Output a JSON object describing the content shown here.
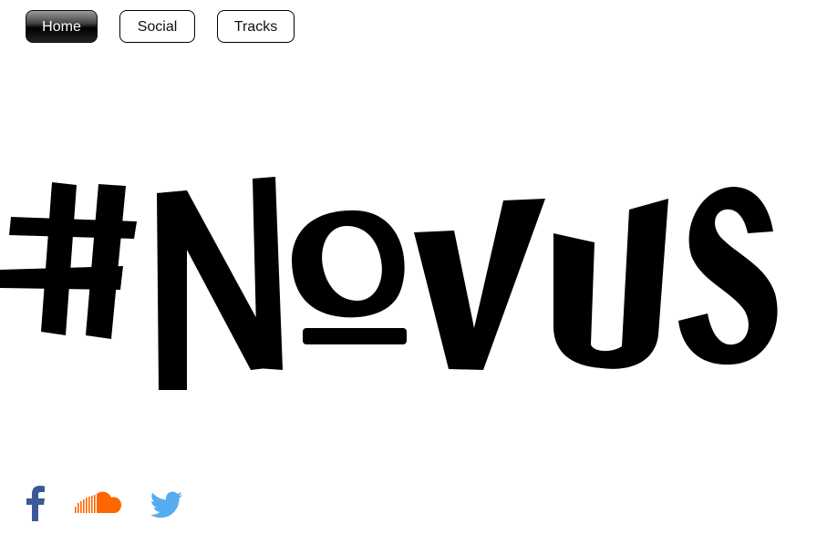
{
  "nav": {
    "items": [
      {
        "label": "Home",
        "active": true
      },
      {
        "label": "Social",
        "active": false
      },
      {
        "label": "Tracks",
        "active": false
      }
    ]
  },
  "logo": {
    "text": "#NoVUS"
  },
  "social": {
    "icons": [
      "facebook-icon",
      "soundcloud-icon",
      "twitter-icon"
    ],
    "colors": {
      "facebook": "#3b5998",
      "soundcloud": "#ff6600",
      "twitter": "#55acee"
    }
  }
}
